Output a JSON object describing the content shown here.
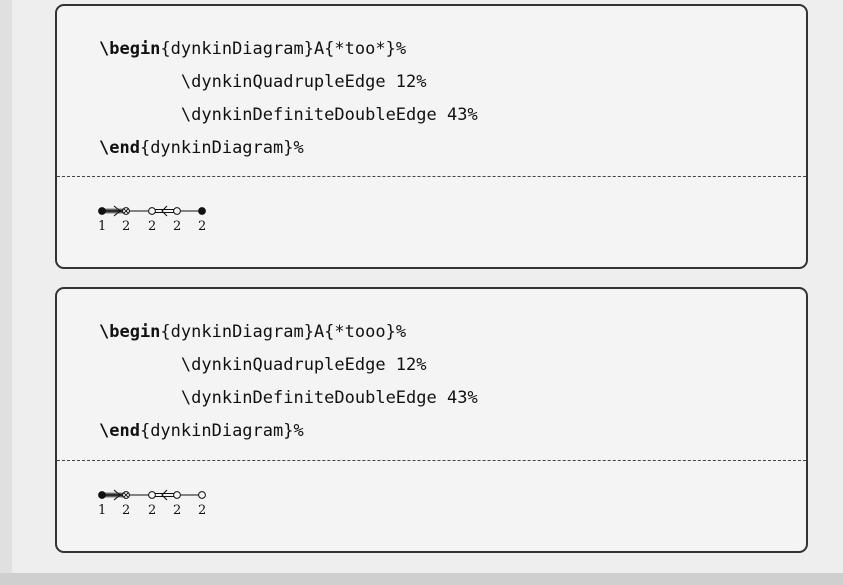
{
  "examples": [
    {
      "code": {
        "line1": {
          "cmd": "\\begin",
          "rest": "{dynkinDiagram}A{*too*}",
          "pct": "%"
        },
        "line2": {
          "text": "        \\dynkinQuadrupleEdge 12",
          "pct": "%"
        },
        "line3": {
          "text": "        \\dynkinDefiniteDoubleEdge 43",
          "pct": "%"
        },
        "line4": {
          "cmd": "\\end",
          "rest": "{dynkinDiagram}",
          "pct": "%"
        }
      },
      "nodes": [
        "filled",
        "crossed",
        "open",
        "open",
        "filled"
      ],
      "labels": [
        "1",
        "2",
        "2",
        "2",
        "2"
      ]
    },
    {
      "code": {
        "line1": {
          "cmd": "\\begin",
          "rest": "{dynkinDiagram}A{*tooo}",
          "pct": "%"
        },
        "line2": {
          "text": "        \\dynkinQuadrupleEdge 12",
          "pct": "%"
        },
        "line3": {
          "text": "        \\dynkinDefiniteDoubleEdge 43",
          "pct": "%"
        },
        "line4": {
          "cmd": "\\end",
          "rest": "{dynkinDiagram}",
          "pct": "%"
        }
      },
      "nodes": [
        "filled",
        "crossed",
        "open",
        "open",
        "open"
      ],
      "labels": [
        "1",
        "2",
        "2",
        "2",
        "2"
      ]
    }
  ]
}
